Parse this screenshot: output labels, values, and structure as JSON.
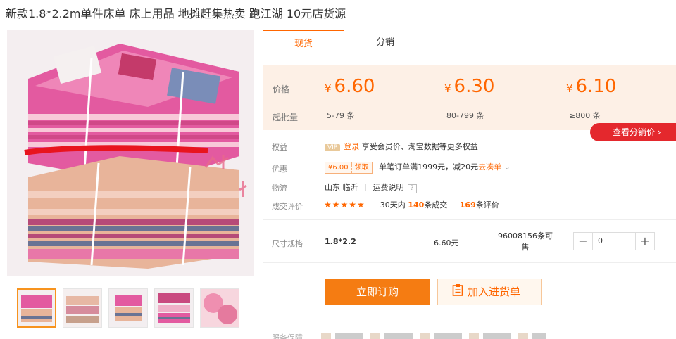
{
  "title": "新款1.8*2.2m单件床单 床上用品 地摊赶集热卖 跑江湖 10元店货源",
  "tabs": [
    "现货",
    "分销"
  ],
  "price_box": {
    "price_label": "价格",
    "qty_label": "起批量",
    "tiers": [
      {
        "price": "6.60",
        "qty": "5-79 条"
      },
      {
        "price": "6.30",
        "qty": "80-799 条"
      },
      {
        "price": "6.10",
        "qty": "≥800 条"
      }
    ],
    "currency": "¥"
  },
  "distribution_button": "查看分销价",
  "rights": {
    "label": "权益",
    "vip": "VIP",
    "login": "登录",
    "text": "享受会员价、淘宝数据等更多权益"
  },
  "discount": {
    "label": "优惠",
    "coupon_amount": "¥6.00",
    "coupon_action": "领取",
    "text": "单笔订单满1999元，减20元",
    "link": "去凑单"
  },
  "logistics": {
    "label": "物流",
    "location": "山东 临沂",
    "shipping": "运费说明"
  },
  "reviews": {
    "label": "成交评价",
    "stars": "★★★★★",
    "prefix": "30天内",
    "sold": "140",
    "sold_suffix": "条成交",
    "review_count": "169",
    "review_suffix": "条评价"
  },
  "spec": {
    "label": "尺寸规格",
    "name": "1.8*2.2",
    "price": "6.60元",
    "stock": "96008156条可售",
    "quantity": "0"
  },
  "actions": {
    "buy": "立即订购",
    "add_to_list": "加入进货单"
  },
  "bottom_peek": "服务保障",
  "colors": {
    "accent": "#ff6600",
    "buy": "#f57c12",
    "price_bg": "#fdf0e6",
    "dist": "#e4282d"
  }
}
